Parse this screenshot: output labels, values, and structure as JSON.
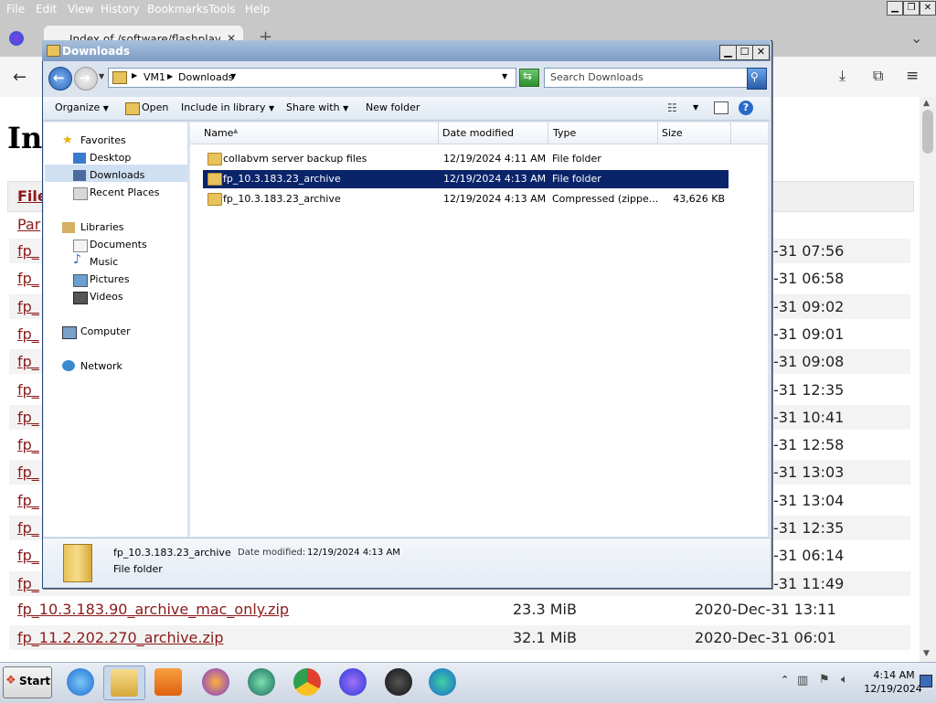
{
  "firefox": {
    "menu": [
      "File",
      "Edit",
      "View",
      "History",
      "Bookmarks",
      "Tools",
      "Help"
    ],
    "tab_title": "Index of /software/flashplayer/pi",
    "page_heading": "Ind",
    "table_header_file": "File",
    "parent_link": "Par",
    "truncated_link": "fp_",
    "dates": [
      "-31 07:56",
      "-31 06:58",
      "-31 09:02",
      "-31 09:01",
      "-31 09:08",
      "-31 12:35",
      "-31 10:41",
      "-31 12:58",
      "-31 13:03",
      "-31 13:04",
      "-31 12:35",
      "-31 06:14",
      "-31 11:49"
    ],
    "full_rows": [
      {
        "name": "fp_10.3.183.90_archive_mac_only.zip",
        "size": "23.3 MiB",
        "date": "2020-Dec-31 13:11"
      },
      {
        "name": "fp_11.2.202.270_archive.zip",
        "size": "32.1 MiB",
        "date": "2020-Dec-31 06:01"
      }
    ]
  },
  "explorer": {
    "title": "Downloads",
    "breadcrumb": [
      "VM1",
      "Downloads"
    ],
    "search_placeholder": "Search Downloads",
    "toolbar": {
      "organize": "Organize",
      "open": "Open",
      "include": "Include in library",
      "share": "Share with",
      "new_folder": "New folder"
    },
    "nav": {
      "favorites": "Favorites",
      "desktop": "Desktop",
      "downloads": "Downloads",
      "recent": "Recent Places",
      "libraries": "Libraries",
      "documents": "Documents",
      "music": "Music",
      "pictures": "Pictures",
      "videos": "Videos",
      "computer": "Computer",
      "network": "Network"
    },
    "columns": {
      "name": "Name",
      "date": "Date modified",
      "type": "Type",
      "size": "Size"
    },
    "files": [
      {
        "name": "collabvm server backup files",
        "date": "12/19/2024 4:11 AM",
        "type": "File folder",
        "size": ""
      },
      {
        "name": "fp_10.3.183.23_archive",
        "date": "12/19/2024 4:13 AM",
        "type": "File folder",
        "size": ""
      },
      {
        "name": "fp_10.3.183.23_archive",
        "date": "12/19/2024 4:13 AM",
        "type": "Compressed (zippe...",
        "size": "43,626 KB"
      }
    ],
    "details": {
      "name": "fp_10.3.183.23_archive",
      "date_label": "Date modified:",
      "date": "12/19/2024 4:13 AM",
      "type": "File folder"
    }
  },
  "taskbar": {
    "start": "Start",
    "time": "4:14 AM",
    "date": "12/19/2024"
  }
}
